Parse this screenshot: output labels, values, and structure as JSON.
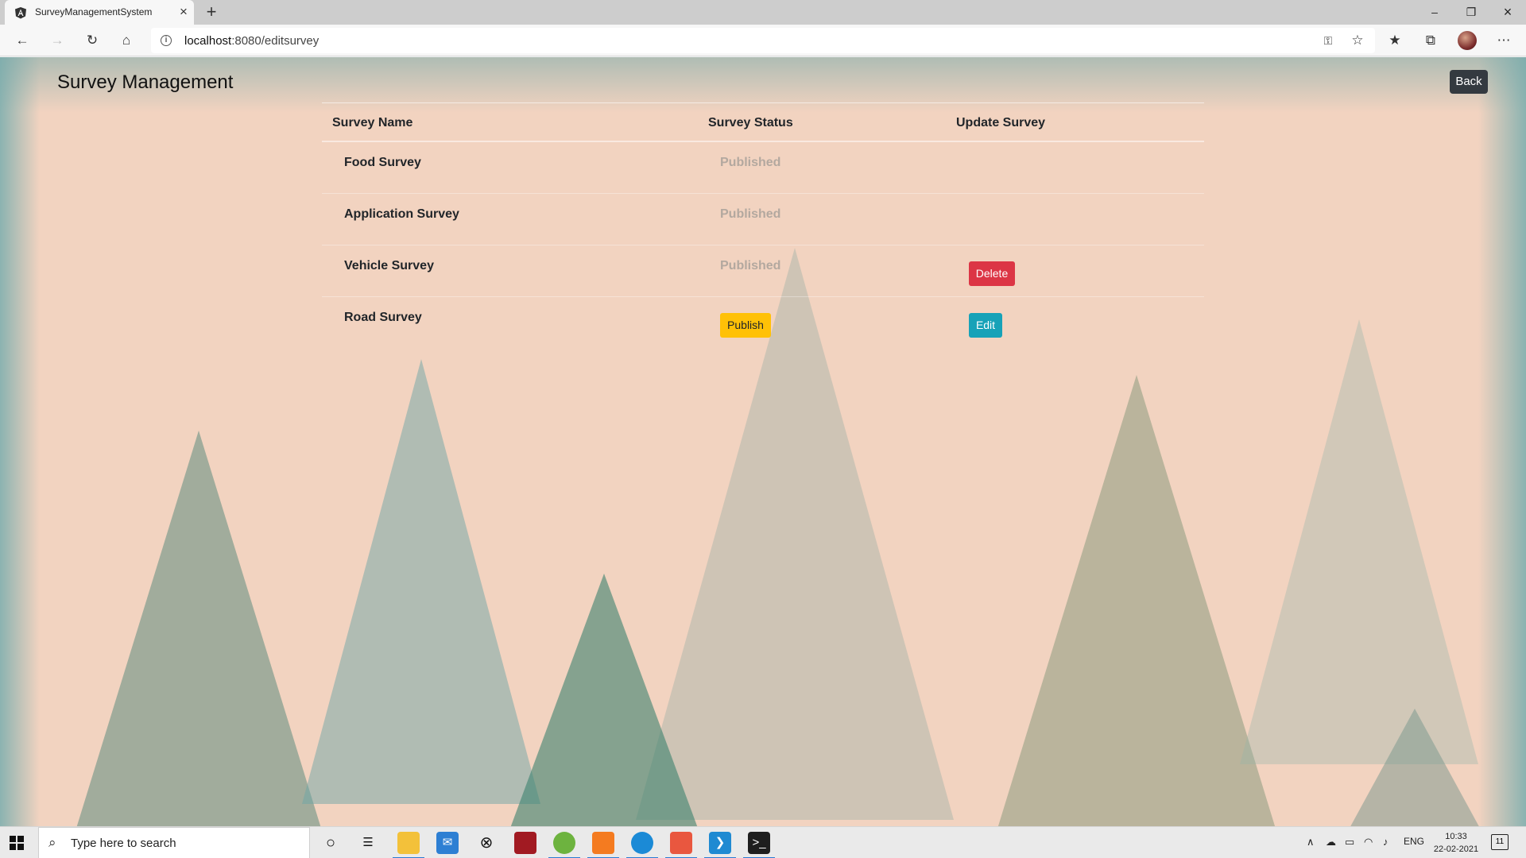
{
  "browser": {
    "tab_title": "SurveyManagementSystem",
    "url_host": "localhost",
    "url_rest": ":8080/editsurvey",
    "icons": [
      "angular-favicon",
      "close-icon",
      "new-tab-icon",
      "minimize-icon",
      "restore-icon",
      "close-window-icon",
      "back-icon",
      "forward-icon",
      "refresh-icon",
      "home-icon",
      "info-icon",
      "key-icon",
      "add-favorite-icon",
      "favorites-icon",
      "collections-icon",
      "profile-avatar",
      "more-icon"
    ]
  },
  "page": {
    "title": "Survey Management",
    "back_label": "Back"
  },
  "table": {
    "headers": [
      "Survey Name",
      "Survey Status",
      "Update Survey"
    ],
    "rows": [
      {
        "name": "Food Survey",
        "status": "Published",
        "publish_label": null,
        "action_label": null
      },
      {
        "name": "Application Survey",
        "status": "Published",
        "publish_label": null,
        "action_label": null
      },
      {
        "name": "Vehicle Survey",
        "status": "Published",
        "publish_label": null,
        "action_label": "Delete"
      },
      {
        "name": "Road Survey",
        "status": null,
        "publish_label": "Publish",
        "action_label": "Edit"
      }
    ]
  },
  "colors": {
    "publish": "#ffc107",
    "delete": "#dc3545",
    "edit": "#17a2b8",
    "back": "#343a40"
  },
  "taskbar": {
    "search_placeholder": "Type here to search",
    "language": "ENG",
    "time": "10:33",
    "date": "22-02-2021",
    "notification_count": "11"
  }
}
